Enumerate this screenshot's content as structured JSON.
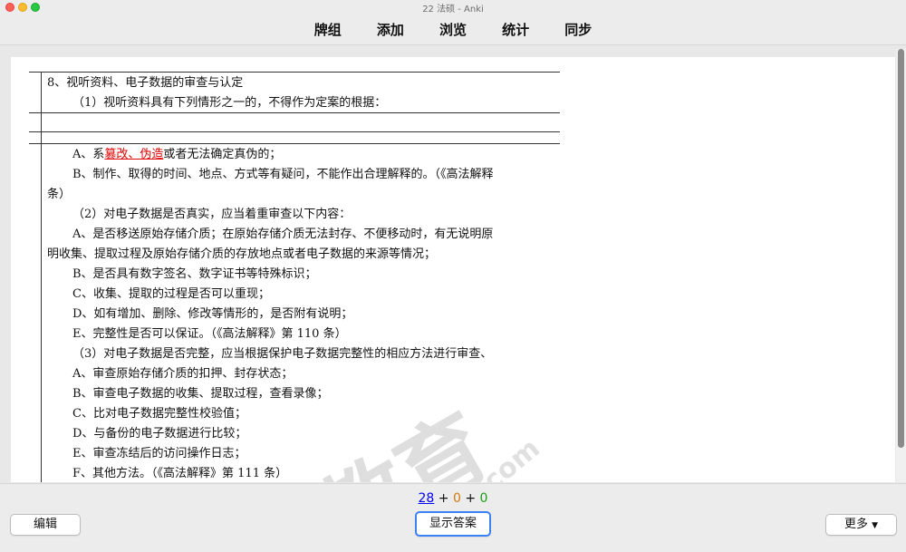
{
  "window": {
    "title": "22 法硕 - Anki"
  },
  "toolbar": {
    "items": [
      "牌组",
      "添加",
      "浏览",
      "统计",
      "同步"
    ]
  },
  "card": {
    "lines": [
      "8、视听资料、电子数据的审查与认定",
      "（1）视听资料具有下列情形之一的，不得作为定案的根据：",
      "B、制作、取得的时间、地点、方式等有疑问，不能作出合理解释的。（《高法解释",
      "条）",
      "（2）对电子数据是否真实，应当着重审查以下内容：",
      "A、是否移送原始存储介质；在原始存储介质无法封存、不便移动时，有无说明原",
      "明收集、提取过程及原始存储介质的存放地点或者电子数据的来源等情况；",
      "B、是否具有数字签名、数字证书等特殊标识；",
      "C、收集、提取的过程是否可以重现；",
      "D、如有增加、删除、修改等情形的，是否附有说明；",
      "E、完整性是否可以保证。（《高法解释》第 110 条）",
      "（3）对电子数据是否完整，应当根据保护电子数据完整性的相应方法进行审查、",
      "A、审查原始存储介质的扣押、封存状态；",
      "B、审查电子数据的收集、提取过程，查看录像；",
      "C、比对电子数据完整性校验值；",
      "D、与备份的电子数据进行比较；",
      "E、审查冻结后的访问操作日志；",
      "F、其他方法。（《高法解释》第 111 条）"
    ],
    "line_a": {
      "prefix": "A、系",
      "highlight": "篡改、伪造",
      "suffix": "或者无法确定真伪的；"
    },
    "watermark": {
      "text": "教育",
      "sub": ".com"
    }
  },
  "counts": {
    "new": "28",
    "plus1": "+",
    "learning": "0",
    "plus2": "+",
    "review": "0"
  },
  "buttons": {
    "edit": "编辑",
    "show_answer": "显示答案",
    "more": "更多"
  },
  "colors": {
    "highlight": "#e00000",
    "new": "#0000ee",
    "learning": "#d4770a",
    "review": "#1c9a1c",
    "focus": "#3b82f6"
  }
}
